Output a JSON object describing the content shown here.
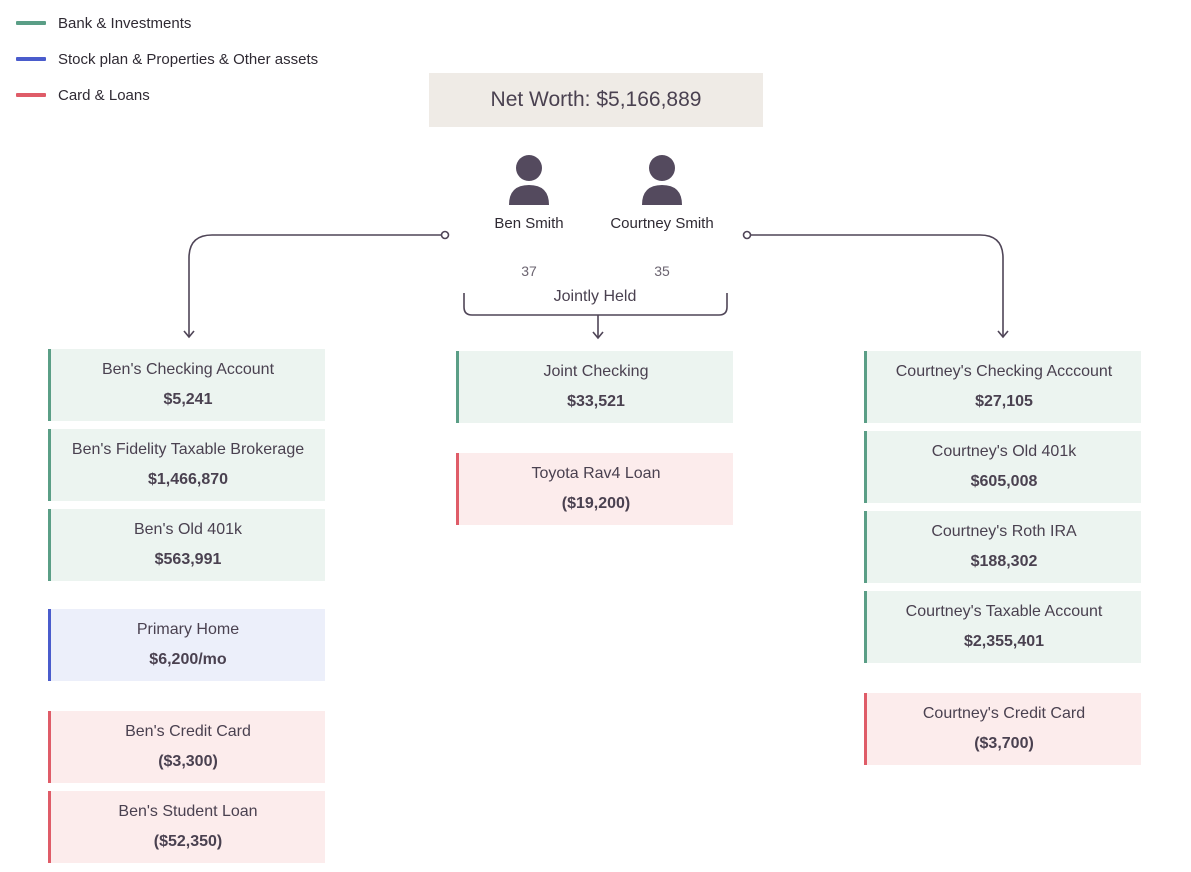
{
  "legend": [
    {
      "label": "Bank & Investments",
      "color": "#5a9e86"
    },
    {
      "label": "Stock plan & Properties & Other assets",
      "color": "#4a5ccc"
    },
    {
      "label": "Card & Loans",
      "color": "#df5c68"
    }
  ],
  "net_worth": "Net Worth: $5,166,889",
  "people": [
    {
      "name": "Ben Smith",
      "age": "37",
      "icon": "person-icon"
    },
    {
      "name": "Courtney Smith",
      "age": "35",
      "icon": "person-icon"
    }
  ],
  "joint_label": "Jointly Held",
  "colors": {
    "line": "#4f4557",
    "person": "#544a5e"
  },
  "columns": {
    "ben": [
      {
        "name": "Ben's Checking Account",
        "value": "$5,241",
        "type": "bank"
      },
      {
        "name": "Ben's Fidelity Taxable Brokerage",
        "value": "$1,466,870",
        "type": "bank"
      },
      {
        "name": "Ben's Old 401k",
        "value": "$563,991",
        "type": "bank"
      },
      {
        "name": "Primary Home",
        "value": "$6,200/mo",
        "type": "asset"
      },
      {
        "name": "Ben's Credit Card",
        "value": "($3,300)",
        "type": "loan"
      },
      {
        "name": "Ben's Student Loan",
        "value": "($52,350)",
        "type": "loan"
      }
    ],
    "joint": [
      {
        "name": "Joint Checking",
        "value": "$33,521",
        "type": "bank"
      },
      {
        "name": "Toyota Rav4 Loan",
        "value": "($19,200)",
        "type": "loan"
      }
    ],
    "courtney": [
      {
        "name": "Courtney's Checking Acccount",
        "value": "$27,105",
        "type": "bank"
      },
      {
        "name": "Courtney's Old 401k",
        "value": "$605,008",
        "type": "bank"
      },
      {
        "name": "Courtney's Roth IRA",
        "value": "$188,302",
        "type": "bank"
      },
      {
        "name": "Courtney's Taxable Account",
        "value": "$2,355,401",
        "type": "bank"
      },
      {
        "name": "Courtney's Credit Card",
        "value": "($3,700)",
        "type": "loan"
      }
    ]
  }
}
